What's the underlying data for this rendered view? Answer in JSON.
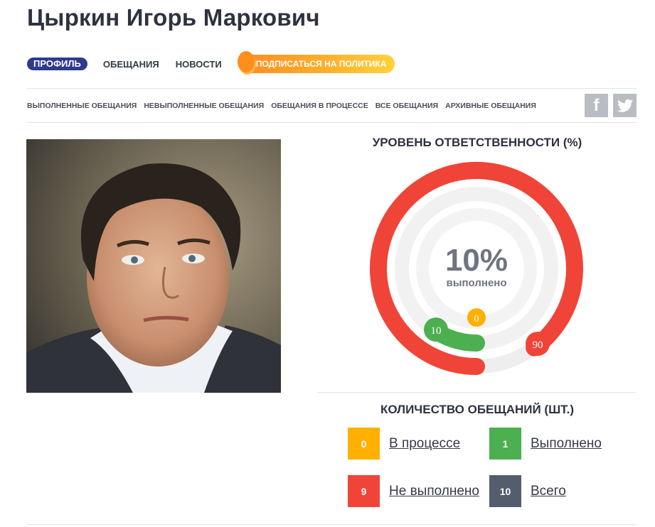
{
  "page": {
    "title": "Цыркин Игорь Маркович"
  },
  "nav": {
    "profile": "ПРОФИЛЬ",
    "promises": "ОБЕЩАНИЯ",
    "news": "НОВОСТИ",
    "subscribe": "ПОДПИСАТЬСЯ НА ПОЛИТИКА"
  },
  "filters": [
    "ВЫПОЛНЕННЫЕ ОБЕЩАНИЯ",
    "НЕВЫПОЛНЕННЫЕ ОБЕЩАНИЯ",
    "ОБЕЩАНИЯ В ПРОЦЕССЕ",
    "ВСЕ ОБЕЩАНИЯ",
    "АРХИВНЫЕ ОБЕЩАНИЯ"
  ],
  "social": {
    "facebook": "f",
    "twitter": "twitter-icon"
  },
  "responsibility": {
    "title": "УРОВЕНЬ ОТВЕТСТВЕННОСТИ (%)",
    "percent": "10%",
    "caption": "выполнено",
    "segments": [
      {
        "label": "90",
        "value": 90,
        "color": "#f04438"
      },
      {
        "label": "10",
        "value": 10,
        "color": "#4caf50"
      },
      {
        "label": "0",
        "value": 0,
        "color": "#ffb000"
      }
    ]
  },
  "count": {
    "title": "КОЛИЧЕСТВО ОБЕЩАНИЙ (ШТ.)",
    "items": [
      {
        "value": "0",
        "label": "В процессе",
        "color": "#ffb000"
      },
      {
        "value": "1",
        "label": "Выполнено",
        "color": "#4caf50"
      },
      {
        "value": "9",
        "label": "Не выполнено",
        "color": "#f04438"
      },
      {
        "value": "10",
        "label": "Всего",
        "color": "#545d6e"
      }
    ]
  }
}
